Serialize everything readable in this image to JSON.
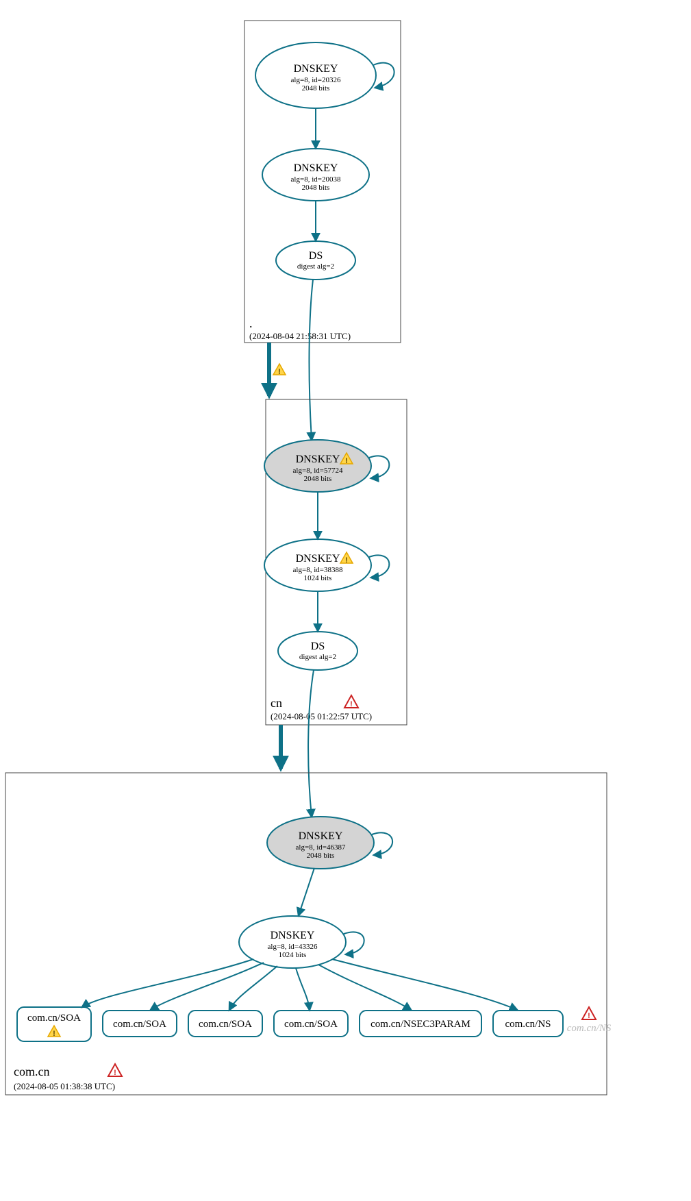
{
  "zones": {
    "root": {
      "label": ".",
      "timestamp": "(2024-08-04 21:58:31 UTC)"
    },
    "cn": {
      "label": "cn",
      "timestamp": "(2024-08-05 01:22:57 UTC)"
    },
    "comcn": {
      "label": "com.cn",
      "timestamp": "(2024-08-05 01:38:38 UTC)"
    }
  },
  "nodes": {
    "root_ksk": {
      "title": "DNSKEY",
      "l1": "alg=8, id=20326",
      "l2": "2048 bits"
    },
    "root_zsk": {
      "title": "DNSKEY",
      "l1": "alg=8, id=20038",
      "l2": "2048 bits"
    },
    "root_ds": {
      "title": "DS",
      "l1": "digest alg=2",
      "l2": ""
    },
    "cn_ksk": {
      "title": "DNSKEY",
      "l1": "alg=8, id=57724",
      "l2": "2048 bits",
      "warn": true
    },
    "cn_zsk": {
      "title": "DNSKEY",
      "l1": "alg=8, id=38388",
      "l2": "1024 bits",
      "warn": true
    },
    "cn_ds": {
      "title": "DS",
      "l1": "digest alg=2",
      "l2": ""
    },
    "comcn_ksk": {
      "title": "DNSKEY",
      "l1": "alg=8, id=46387",
      "l2": "2048 bits"
    },
    "comcn_zsk": {
      "title": "DNSKEY",
      "l1": "alg=8, id=43326",
      "l2": "1024 bits"
    }
  },
  "rrsets": {
    "r1": {
      "label": "com.cn/SOA",
      "warn": true
    },
    "r2": {
      "label": "com.cn/SOA"
    },
    "r3": {
      "label": "com.cn/SOA"
    },
    "r4": {
      "label": "com.cn/SOA"
    },
    "r5": {
      "label": "com.cn/NSEC3PARAM"
    },
    "r6": {
      "label": "com.cn/NS"
    },
    "r7": {
      "label": "com.cn/NS",
      "missing": true,
      "error": true
    }
  },
  "colors": {
    "stroke": "#0e7187",
    "ksk_fill": "#d4d4d4"
  }
}
